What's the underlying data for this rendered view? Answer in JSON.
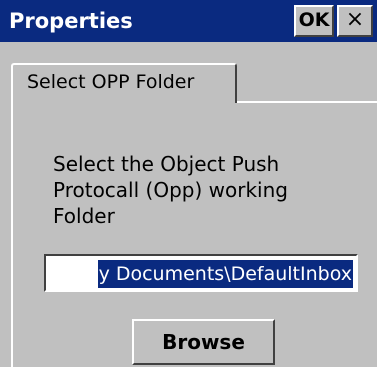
{
  "window": {
    "title": "Properties",
    "ok_label": "OK",
    "close_label": "×"
  },
  "tabs": [
    {
      "label": "Select OPP Folder",
      "selected": true
    }
  ],
  "page": {
    "description": "Select the Object Push\nProtocall (Opp) working\nFolder",
    "folder_path_visible": "y Documents\\DefaultInbox",
    "browse_label": "Browse"
  },
  "colors": {
    "titlebar": "#0a2a80",
    "face": "#c0c0c0",
    "selection": "#0a2a80"
  },
  "icons": {
    "close": "close-icon"
  }
}
